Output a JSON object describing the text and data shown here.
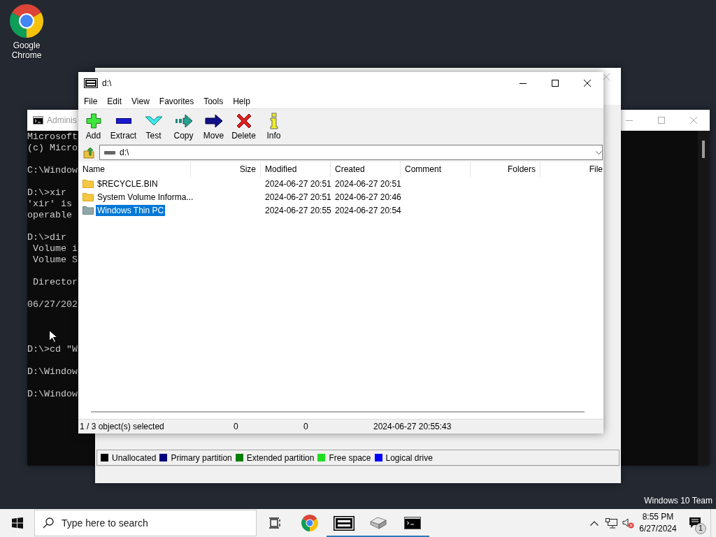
{
  "desktop_icons": [
    {
      "label": "Google Chrome",
      "kind": "browser"
    }
  ],
  "cmd_window": {
    "title": "Adminis",
    "blocks": [
      {
        "kind": "top",
        "lines": [
          "Microsoft",
          "(c) Micro"
        ]
      },
      {
        "kind": "spaced",
        "lines": [
          "C:\\Window"
        ]
      },
      {
        "kind": "spaced",
        "lines": [
          "D:\\>xir",
          "'xir' is",
          "operable"
        ]
      },
      {
        "kind": "spaced",
        "lines": [
          "D:\\>dir",
          " Volume i",
          " Volume S"
        ]
      },
      {
        "kind": "spaced",
        "lines": [
          " Director"
        ]
      },
      {
        "kind": "spaced",
        "lines": [
          "06/27/202"
        ]
      },
      {
        "kind": "wide",
        "lines": [
          "D:\\>cd \"W"
        ]
      },
      {
        "kind": "spaced",
        "lines": [
          "D:\\Window"
        ]
      },
      {
        "kind": "spaced",
        "lines": [
          "D:\\Window"
        ]
      }
    ]
  },
  "disk_window": {
    "legend": [
      {
        "label": "Unallocated",
        "color": "#000000"
      },
      {
        "label": "Primary partition",
        "color": "#000080"
      },
      {
        "label": "Extended partition",
        "color": "#008000"
      },
      {
        "label": "Free space",
        "color": "#22dd22"
      },
      {
        "label": "Logical drive",
        "color": "#0000ff"
      }
    ]
  },
  "archive_window": {
    "title": "d:\\",
    "menu": [
      "File",
      "Edit",
      "View",
      "Favorites",
      "Tools",
      "Help"
    ],
    "toolbar": [
      {
        "label": "Add",
        "kind": "add"
      },
      {
        "label": "Extract",
        "kind": "extract"
      },
      {
        "label": "Test",
        "kind": "test"
      },
      {
        "label": "Copy",
        "kind": "copy"
      },
      {
        "label": "Move",
        "kind": "move"
      },
      {
        "label": "Delete",
        "kind": "delete"
      },
      {
        "label": "Info",
        "kind": "info"
      }
    ],
    "address": "d:\\",
    "columns": [
      {
        "label": "Name",
        "kind": "text"
      },
      {
        "label": "Size",
        "kind": "number"
      },
      {
        "label": "Modified",
        "kind": "text"
      },
      {
        "label": "Created",
        "kind": "text"
      },
      {
        "label": "Comment",
        "kind": "text"
      },
      {
        "label": "Folders",
        "kind": "number"
      },
      {
        "label": "File",
        "kind": "number"
      }
    ],
    "rows": [
      {
        "name": "$RECYCLE.BIN",
        "modified": "2024-06-27 20:51",
        "created": "2024-06-27 20:51",
        "selected": false
      },
      {
        "name": "System Volume Informa...",
        "modified": "2024-06-27 20:51",
        "created": "2024-06-27 20:46",
        "selected": false
      },
      {
        "name": "Windows Thin PC",
        "modified": "2024-06-27 20:55",
        "created": "2024-06-27 20:54",
        "selected": true
      }
    ],
    "status": [
      "1 / 3 object(s) selected",
      "0",
      "0",
      "2024-06-27 20:55:43"
    ]
  },
  "edition_text": "Windows 10 Team",
  "taskbar": {
    "search": {
      "placeholder": "Type here to search"
    },
    "apps": [
      {
        "kind": "taskview",
        "running": false
      },
      {
        "kind": "browser",
        "running": false
      },
      {
        "kind": "archiver",
        "running": true
      },
      {
        "kind": "disk",
        "running": true
      },
      {
        "kind": "console",
        "running": true
      }
    ],
    "time": "8:55 PM",
    "date": "6/27/2024",
    "notification_count": "1"
  }
}
